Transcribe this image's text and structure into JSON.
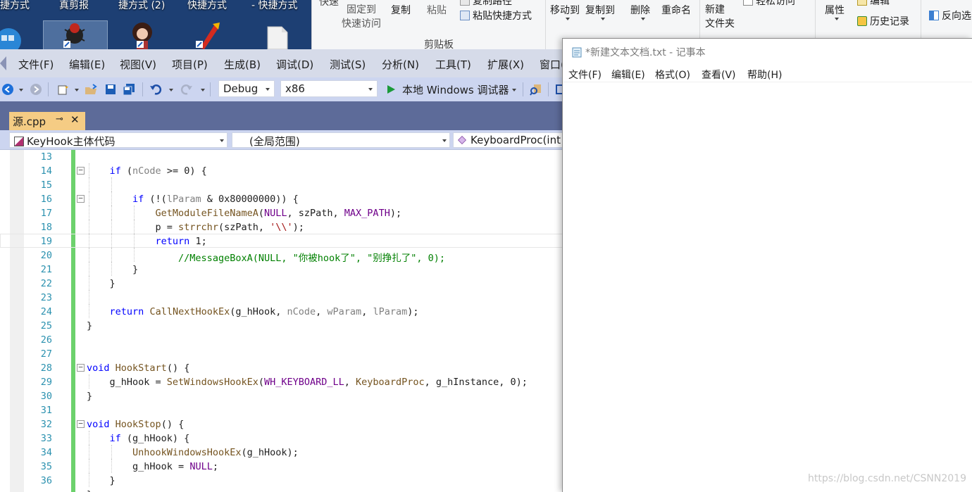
{
  "desktop": {
    "labels": [
      "捷方式",
      "真剪报",
      "捷方式 (2)",
      "快捷方式",
      "- 快捷方式"
    ]
  },
  "ribbon": {
    "pin_quick_access": "固定到\n快速访问",
    "copy": "复制",
    "paste": "粘贴",
    "copy_path": "复制路径",
    "paste_shortcut": "粘贴快捷方式",
    "clipboard_group": "剪贴板",
    "move_to": "移动到",
    "copy_to": "复制到",
    "delete": "删除",
    "rename": "重命名",
    "new_folder": "新建\n文件夹",
    "properties": "属性",
    "edit": "编辑",
    "history": "历史记录",
    "invert_selection": "反向选",
    "partial_top": "快速",
    "easy_access": "轻松访问"
  },
  "vs": {
    "menu": [
      "文件(F)",
      "编辑(E)",
      "视图(V)",
      "项目(P)",
      "生成(B)",
      "调试(D)",
      "测试(S)",
      "分析(N)",
      "工具(T)",
      "扩展(X)",
      "窗口("
    ],
    "toolbar": {
      "config": "Debug",
      "platform": "x86",
      "run_label": "本地 Windows 调试器"
    },
    "tab": {
      "name": "源.cpp",
      "pin": "⊸",
      "close": "✕"
    },
    "nav": {
      "project": "KeyHook主体代码",
      "scope": "(全局范围)",
      "member": "KeyboardProc(int"
    },
    "editor": {
      "lines": [
        {
          "n": "13",
          "fold": "",
          "guides": [],
          "seg": []
        },
        {
          "n": "14",
          "fold": "−",
          "guides": [
            123
          ],
          "seg": [
            [
              "pl",
              "    "
            ],
            [
              "kw",
              "if"
            ],
            [
              "pl",
              " ("
            ],
            [
              "prm",
              "nCode"
            ],
            [
              "pl",
              " >= 0) {"
            ]
          ]
        },
        {
          "n": "15",
          "fold": "",
          "guides": [
            123,
            155
          ],
          "seg": []
        },
        {
          "n": "16",
          "fold": "−",
          "guides": [
            123,
            155
          ],
          "seg": [
            [
              "pl",
              "        "
            ],
            [
              "kw",
              "if"
            ],
            [
              "pl",
              " (!("
            ],
            [
              "prm",
              "lParam"
            ],
            [
              "pl",
              " & 0x80000000)) {"
            ]
          ]
        },
        {
          "n": "17",
          "fold": "",
          "guides": [
            123,
            155,
            187
          ],
          "seg": [
            [
              "pl",
              "            "
            ],
            [
              "fn",
              "GetModuleFileNameA"
            ],
            [
              "pl",
              "("
            ],
            [
              "mac",
              "NULL"
            ],
            [
              "pl",
              ", szPath, "
            ],
            [
              "mac",
              "MAX_PATH"
            ],
            [
              "pl",
              ");"
            ]
          ]
        },
        {
          "n": "18",
          "fold": "",
          "guides": [
            123,
            155,
            187
          ],
          "seg": [
            [
              "pl",
              "            p = "
            ],
            [
              "fn",
              "strrchr"
            ],
            [
              "pl",
              "(szPath, "
            ],
            [
              "str",
              "'\\\\'"
            ],
            [
              "pl",
              ");"
            ]
          ]
        },
        {
          "n": "19",
          "fold": "",
          "guides": [
            123,
            155,
            187
          ],
          "cur": true,
          "seg": [
            [
              "pl",
              "            "
            ],
            [
              "kw",
              "return"
            ],
            [
              "pl",
              " 1;"
            ]
          ]
        },
        {
          "n": "20",
          "fold": "",
          "guides": [
            123,
            155,
            187
          ],
          "seg": [
            [
              "pl",
              "                "
            ],
            [
              "cmt",
              "//MessageBoxA(NULL, \"你被hook了\", \"别挣扎了\", 0);"
            ]
          ]
        },
        {
          "n": "21",
          "fold": "",
          "guides": [
            123,
            155
          ],
          "seg": [
            [
              "pl",
              "        }"
            ]
          ]
        },
        {
          "n": "22",
          "fold": "",
          "guides": [
            123
          ],
          "seg": [
            [
              "pl",
              "    }"
            ]
          ]
        },
        {
          "n": "23",
          "fold": "",
          "guides": [
            123
          ],
          "seg": []
        },
        {
          "n": "24",
          "fold": "",
          "guides": [
            123
          ],
          "seg": [
            [
              "pl",
              "    "
            ],
            [
              "kw",
              "return"
            ],
            [
              "pl",
              " "
            ],
            [
              "fn",
              "CallNextHookEx"
            ],
            [
              "pl",
              "(g_hHook, "
            ],
            [
              "prm",
              "nCode"
            ],
            [
              "pl",
              ", "
            ],
            [
              "prm",
              "wParam"
            ],
            [
              "pl",
              ", "
            ],
            [
              "prm",
              "lParam"
            ],
            [
              "pl",
              ");"
            ]
          ]
        },
        {
          "n": "25",
          "fold": "",
          "guides": [],
          "seg": [
            [
              "pl",
              "}"
            ]
          ]
        },
        {
          "n": "26",
          "fold": "",
          "guides": [],
          "seg": []
        },
        {
          "n": "27",
          "fold": "",
          "guides": [],
          "seg": []
        },
        {
          "n": "28",
          "fold": "−",
          "guides": [],
          "seg": [
            [
              "kw",
              "void"
            ],
            [
              "pl",
              " "
            ],
            [
              "fn",
              "HookStart"
            ],
            [
              "pl",
              "() {"
            ]
          ]
        },
        {
          "n": "29",
          "fold": "",
          "guides": [
            123
          ],
          "seg": [
            [
              "pl",
              "    g_hHook = "
            ],
            [
              "fn",
              "SetWindowsHookEx"
            ],
            [
              "pl",
              "("
            ],
            [
              "mac",
              "WH_KEYBOARD_LL"
            ],
            [
              "pl",
              ", "
            ],
            [
              "fn",
              "KeyboardProc"
            ],
            [
              "pl",
              ", g_hInstance, 0);"
            ]
          ]
        },
        {
          "n": "30",
          "fold": "",
          "guides": [],
          "seg": [
            [
              "pl",
              "}"
            ]
          ]
        },
        {
          "n": "31",
          "fold": "",
          "guides": [],
          "seg": []
        },
        {
          "n": "32",
          "fold": "−",
          "guides": [],
          "seg": [
            [
              "kw",
              "void"
            ],
            [
              "pl",
              " "
            ],
            [
              "fn",
              "HookStop"
            ],
            [
              "pl",
              "() {"
            ]
          ]
        },
        {
          "n": "33",
          "fold": "",
          "guides": [
            123
          ],
          "seg": [
            [
              "pl",
              "    "
            ],
            [
              "kw",
              "if"
            ],
            [
              "pl",
              " (g_hHook) {"
            ]
          ]
        },
        {
          "n": "34",
          "fold": "",
          "guides": [
            123,
            155
          ],
          "seg": [
            [
              "pl",
              "        "
            ],
            [
              "fn",
              "UnhookWindowsHookEx"
            ],
            [
              "pl",
              "(g_hHook);"
            ]
          ]
        },
        {
          "n": "35",
          "fold": "",
          "guides": [
            123,
            155
          ],
          "seg": [
            [
              "pl",
              "        g_hHook = "
            ],
            [
              "mac",
              "NULL"
            ],
            [
              "pl",
              ";"
            ]
          ]
        },
        {
          "n": "36",
          "fold": "",
          "guides": [
            123
          ],
          "seg": [
            [
              "pl",
              "    }"
            ]
          ]
        },
        {
          "n": "",
          "fold": "",
          "guides": [],
          "seg": [
            [
              "pl",
              "}"
            ]
          ]
        }
      ]
    }
  },
  "notepad": {
    "title": "*新建文本文档.txt - 记事本",
    "menu": [
      "文件(F)",
      "编辑(E)",
      "格式(O)",
      "查看(V)",
      "帮助(H)"
    ],
    "content": ""
  },
  "watermark": "https://blog.csdn.net/CSNN2019",
  "colors": {
    "vs_accent": "#f5cc84",
    "vs_tabstrip": "#5d6b99",
    "change_bar": "#6cd16c",
    "keyword": "#0000ff",
    "comment": "#008000"
  }
}
